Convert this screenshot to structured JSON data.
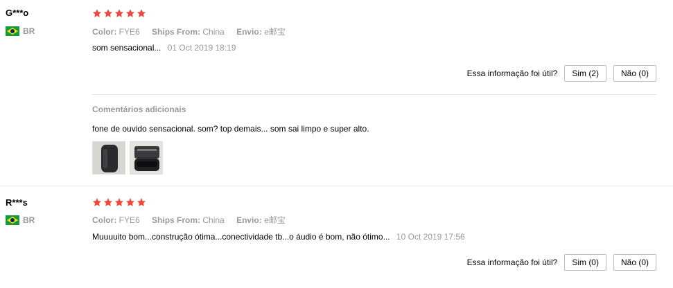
{
  "reviews": [
    {
      "user": "G***o",
      "country": "BR",
      "rating": 5,
      "attrs": [
        {
          "label": "Color:",
          "value": "FYE6"
        },
        {
          "label": "Ships From:",
          "value": "China"
        },
        {
          "label": "Envio:",
          "value": "e邮宝"
        }
      ],
      "text": "som sensacional...",
      "date": "01 Oct 2019 18:19",
      "helpful_question": "Essa informação foi útil?",
      "yes_label": "Sim (2)",
      "no_label": "Não (0)",
      "additional_title": "Comentários adicionais",
      "additional_text": "fone de ouvido sensacional. som? top demais... som sai limpo e super alto.",
      "photos": [
        "earbuds-case-closed-photo",
        "earbuds-case-open-photo"
      ]
    },
    {
      "user": "R***s",
      "country": "BR",
      "rating": 5,
      "attrs": [
        {
          "label": "Color:",
          "value": "FYE6"
        },
        {
          "label": "Ships From:",
          "value": "China"
        },
        {
          "label": "Envio:",
          "value": "e邮宝"
        }
      ],
      "text": "Muuuuito bom...construção ótima...conectividade tb...o áudio é bom, não ótimo...",
      "date": "10 Oct 2019 17:56",
      "helpful_question": "Essa informação foi útil?",
      "yes_label": "Sim (0)",
      "no_label": "Não (0)"
    }
  ],
  "colors": {
    "star": "#f44336",
    "muted": "#999999",
    "border": "#e6e6e6",
    "flag_green": "#169b3a",
    "flag_yellow": "#fedf00",
    "flag_blue": "#002776"
  }
}
